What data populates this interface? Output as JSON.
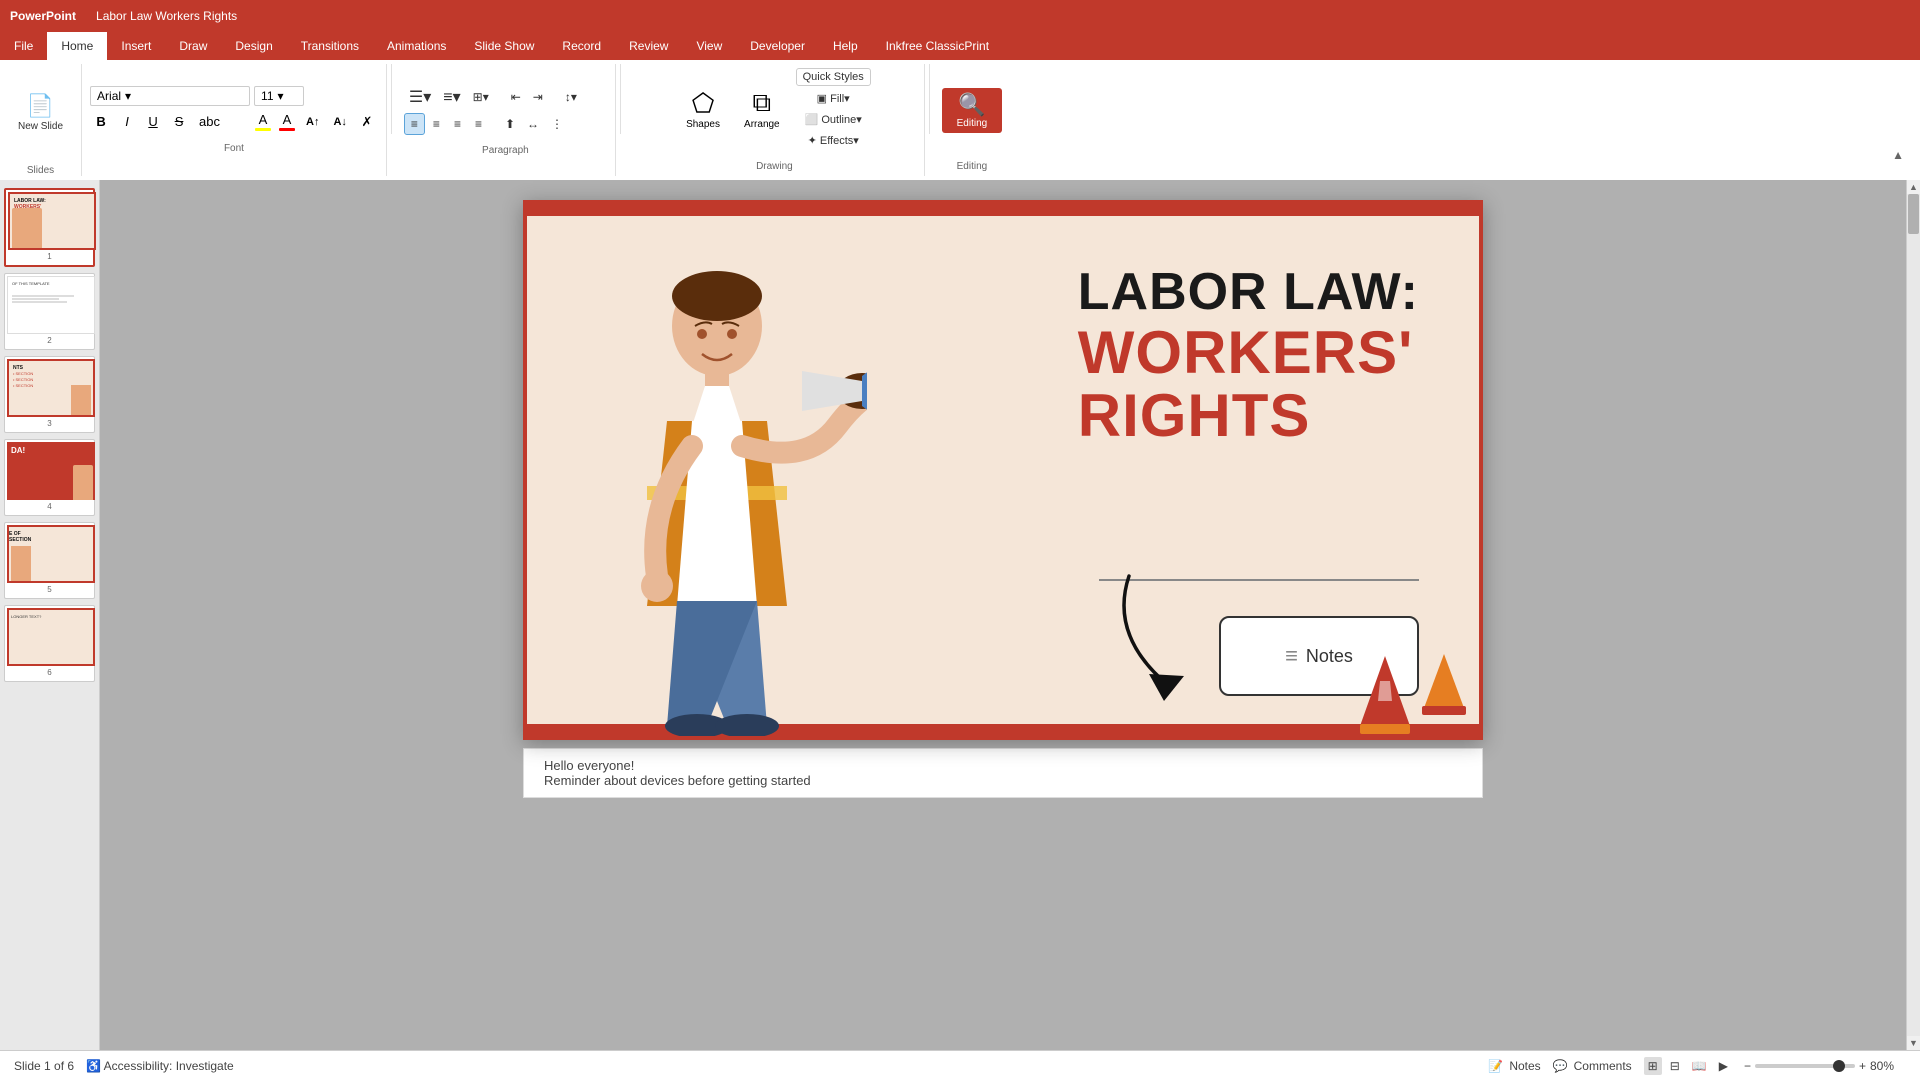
{
  "titleBar": {
    "appName": "PowerPoint",
    "fileName": "Labor Law Workers Rights"
  },
  "ribbon": {
    "tabs": [
      "File",
      "Home",
      "Insert",
      "Draw",
      "Design",
      "Transitions",
      "Animations",
      "Slide Show",
      "Record",
      "Review",
      "View",
      "Developer",
      "Help",
      "Inkfree ClassicPrint"
    ],
    "activeTab": "Home",
    "groups": {
      "slides": {
        "label": "Slides",
        "newSlide": "New Slide"
      },
      "font": {
        "label": "Font",
        "fontName": "Arial",
        "fontSize": "11",
        "bold": "B",
        "italic": "I",
        "underline": "U",
        "strikethrough": "S",
        "textHighlight": "A",
        "fontColor": "A"
      },
      "paragraph": {
        "label": "Paragraph"
      },
      "drawing": {
        "label": "Drawing",
        "shapesLabel": "Shapes",
        "arrangeLabel": "Arrange",
        "quickStylesLabel": "Quick Styles"
      },
      "editing": {
        "label": "Editing",
        "editingLabel": "Editing"
      }
    }
  },
  "slides": [
    {
      "id": 1,
      "active": true,
      "title": "LABOR LAW: WORKERS' RIGHTS",
      "bg": "peach"
    },
    {
      "id": 2,
      "active": false,
      "title": "OF THIS TEMPLATE",
      "bg": "white"
    },
    {
      "id": 3,
      "active": false,
      "title": "NTS",
      "bg": "peach"
    },
    {
      "id": 4,
      "active": false,
      "title": "DA!",
      "bg": "red"
    },
    {
      "id": 5,
      "active": false,
      "title": "E OF SECTION",
      "bg": "peach"
    },
    {
      "id": 6,
      "active": false,
      "title": "LONGER TEXT?",
      "bg": "peach"
    }
  ],
  "currentSlide": {
    "title": "LABOR LAW:",
    "subtitle1": "WORKERS'",
    "subtitle2": "RIGHTS",
    "notesCallout": "Notes",
    "notesIcon": "≡"
  },
  "notesBar": {
    "line1": "Hello everyone!",
    "line2": "Reminder about devices before getting started"
  },
  "statusBar": {
    "slideInfo": "Slide 1 of 6",
    "accessibility": "Accessibility: Investigate",
    "notesLabel": "Notes",
    "commentsLabel": "Comments",
    "zoomPercent": "80%",
    "zoomMinus": "−",
    "zoomPlus": "+"
  }
}
